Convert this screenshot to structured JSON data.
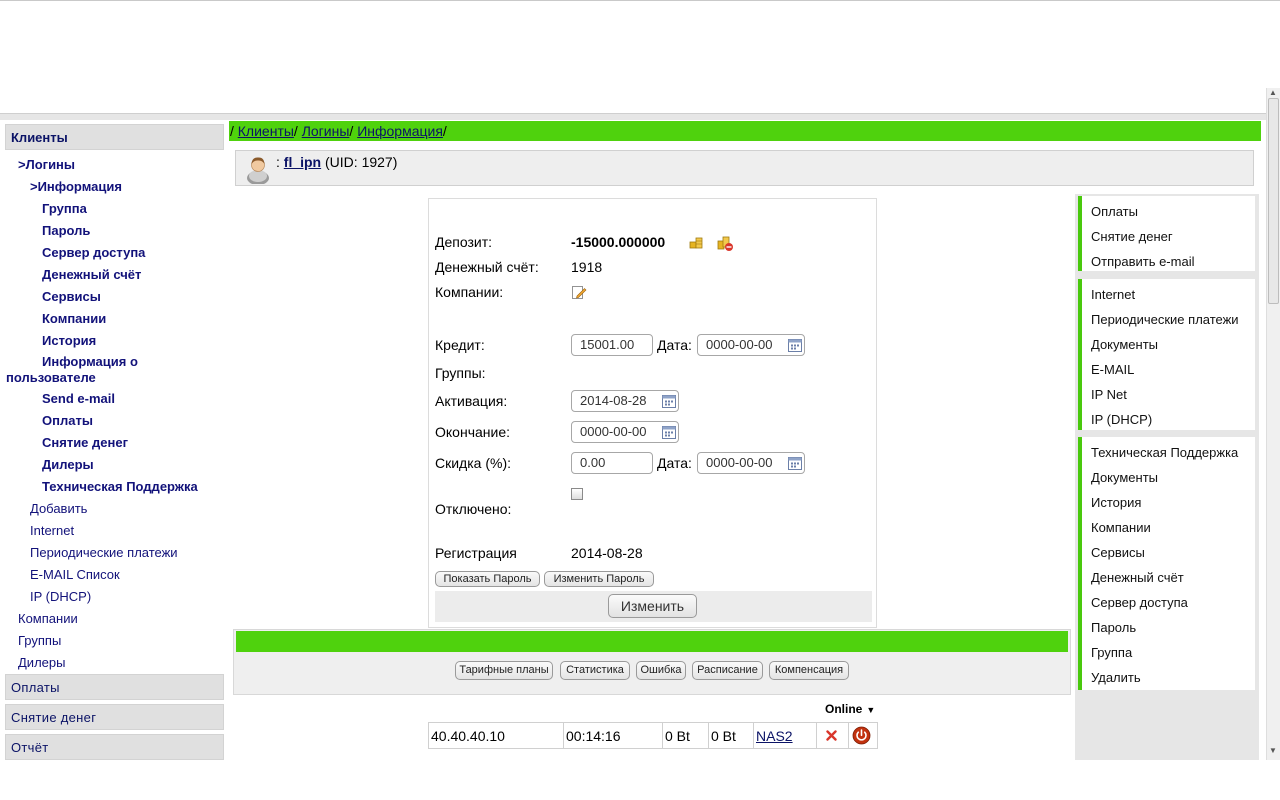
{
  "nav": {
    "clients_header": "Клиенты",
    "items": [
      {
        "label": ">Логины",
        "bold": true
      },
      {
        "label": ">Информация",
        "bold": true
      },
      {
        "label": "Группа",
        "bold": true
      },
      {
        "label": "Пароль",
        "bold": true
      },
      {
        "label": "Сервер доступа",
        "bold": true
      },
      {
        "label": "Денежный счёт",
        "bold": true
      },
      {
        "label": "Сервисы",
        "bold": true
      },
      {
        "label": "Компании",
        "bold": true
      },
      {
        "label": "История",
        "bold": true
      },
      {
        "label": "Информация о",
        "bold": true
      },
      {
        "label": "пользователе",
        "bold": true
      },
      {
        "label": "Send e-mail",
        "bold": true
      },
      {
        "label": "Оплаты",
        "bold": true
      },
      {
        "label": "Снятие денег",
        "bold": true
      },
      {
        "label": "Дилеры",
        "bold": true
      },
      {
        "label": "Техническая Поддержка",
        "bold": true
      },
      {
        "label": "Добавить",
        "bold": false
      },
      {
        "label": "Internet",
        "bold": false
      },
      {
        "label": "Периодические платежи",
        "bold": false
      },
      {
        "label": "E-MAIL Список",
        "bold": false
      },
      {
        "label": "IP (DHCP)",
        "bold": false
      },
      {
        "label": "Компании",
        "bold": false
      },
      {
        "label": "Группы",
        "bold": false
      },
      {
        "label": "Дилеры",
        "bold": false
      }
    ],
    "payments_header": "Оплаты",
    "withdraw_header": "Снятие денег",
    "report_header": "Отчёт"
  },
  "breadcrumb": [
    "Клиенты",
    "Логины",
    "Информация"
  ],
  "user": {
    "login": "fl_ipn",
    "uid_text": "(UID: 1927)"
  },
  "form": {
    "deposit_label": "Депозит:",
    "deposit_value": "-15000.000000",
    "account_label": "Денежный счёт:",
    "account_value": "1918",
    "companies_label": "Компании:",
    "credit_label": "Кредит:",
    "credit_value": "15001.00",
    "date_label": "Дата:",
    "credit_date": "0000-00-00",
    "groups_label": "Группы:",
    "activation_label": "Активация:",
    "activation_value": "2014-08-28",
    "expire_label": "Окончание:",
    "expire_value": "0000-00-00",
    "discount_label": "Скидка (%):",
    "discount_value": "0.00",
    "discount_date": "0000-00-00",
    "disabled_label": "Отключено:",
    "registration_label": "Регистрация",
    "registration_value": "2014-08-28",
    "show_password": "Показать Пароль",
    "change_password": "Изменить Пароль",
    "change_button": "Изменить"
  },
  "right_menu": {
    "group1": [
      "Оплаты",
      "Снятие денег",
      "Отправить e-mail"
    ],
    "group2": [
      "Internet",
      "Периодические платежи",
      "Документы",
      "E-MAIL",
      "IP Net",
      "IP (DHCP)"
    ],
    "group3": [
      "Техническая Поддержка",
      "Документы",
      "История",
      "Компании",
      "Сервисы",
      "Денежный счёт",
      "Сервер доступа",
      "Пароль",
      "Группа",
      "Удалить"
    ]
  },
  "tabs": [
    "Тарифные планы",
    "Статистика",
    "Ошибка",
    "Расписание",
    "Компенсация"
  ],
  "online": {
    "header": "Online",
    "row": {
      "ip": "40.40.40.10",
      "duration": "00:14:16",
      "in": "0 Bt",
      "out": "0 Bt",
      "nas": "NAS2"
    }
  },
  "colors": {
    "accent_green": "#4fd20d",
    "link_navy": "#0b1366"
  }
}
